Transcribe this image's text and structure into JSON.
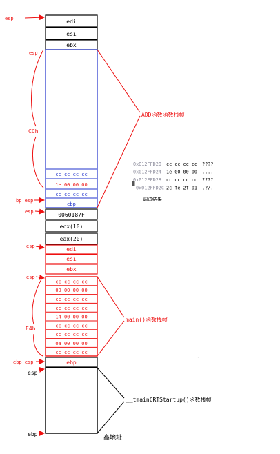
{
  "colors": {
    "black": "#000000",
    "red": "#ee1111",
    "blue": "#2233cc",
    "gray": "#8a8a9a"
  },
  "stack_top": [
    "edi",
    "esi",
    "ebx"
  ],
  "add_frame": {
    "title": "ADD函数函数栈帧",
    "size_label": "CCh",
    "cells": [
      "cc cc cc cc",
      "1e 00 00 00",
      "cc cc cc cc",
      "ebp"
    ],
    "return_address": "0060187F",
    "args": [
      "ecx(10)",
      "eax(20)"
    ]
  },
  "main_frame": {
    "title": "main()函数栈帧",
    "size_label": "E4h",
    "registers": [
      "edi",
      "esi",
      "ebx"
    ],
    "cells": [
      "cc cc cc cc",
      "00 00 00 00",
      "cc cc cc cc",
      "cc cc cc cc",
      "14 00 00 00",
      "cc cc cc cc",
      "cc cc cc cc",
      "0a 00 00 00",
      "cc cc cc cc"
    ],
    "ebp_cell": "ebp"
  },
  "crt_frame": {
    "title": "__tmainCRTStartup()函数栈帧",
    "bottom_label": "高地址"
  },
  "pointers": {
    "esp_top": "esp",
    "esp_add": "esp",
    "bp_esp": "bp esp",
    "esp_ret": "esp",
    "esp_main_top": "esp",
    "esp_main_cells": "esp",
    "ebp_esp": "ebp  esp",
    "esp_crt": "esp",
    "ebp_crt": "ebp"
  },
  "memory_dump": {
    "rows": [
      {
        "addr": "0x012FFD20",
        "bytes": "cc cc cc cc",
        "ascii": "????"
      },
      {
        "addr": "0x012FFD24",
        "bytes": "1e 00 00 00",
        "ascii": "...."
      },
      {
        "addr": "0x012FFD28",
        "bytes": "cc cc cc cc",
        "ascii": "????"
      },
      {
        "addr": "0x012FFD2C",
        "bytes": "2c fe 2f 01",
        "ascii": ",?/."
      }
    ],
    "caption": "调试结果"
  }
}
